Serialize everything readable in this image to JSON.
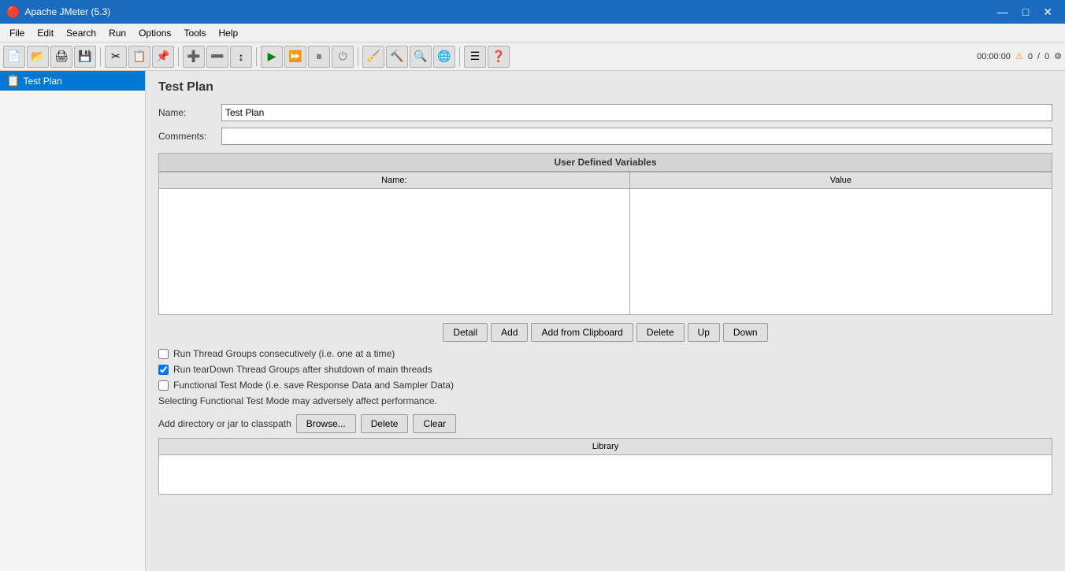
{
  "titlebar": {
    "icon": "🔴",
    "title": "Apache JMeter (5.3)",
    "minimize": "—",
    "maximize": "□",
    "close": "✕"
  },
  "menu": {
    "items": [
      "File",
      "Edit",
      "Search",
      "Run",
      "Options",
      "Tools",
      "Help"
    ]
  },
  "toolbar": {
    "buttons": [
      {
        "name": "new-btn",
        "icon": "📄"
      },
      {
        "name": "open-btn",
        "icon": "📂"
      },
      {
        "name": "save-copy-btn",
        "icon": "🖨"
      },
      {
        "name": "save-btn",
        "icon": "💾"
      },
      {
        "name": "cut-btn",
        "icon": "✂"
      },
      {
        "name": "copy-btn",
        "icon": "📋"
      },
      {
        "name": "paste-btn",
        "icon": "📌"
      },
      {
        "name": "expand-btn",
        "icon": "➕"
      },
      {
        "name": "collapse-btn",
        "icon": "➖"
      },
      {
        "name": "toggle-btn",
        "icon": "↕"
      },
      {
        "name": "play-btn",
        "icon": "▶"
      },
      {
        "name": "play-no-pause-btn",
        "icon": "⏩"
      },
      {
        "name": "stop-btn",
        "icon": "⏹"
      },
      {
        "name": "shutdown-btn",
        "icon": "⏻"
      },
      {
        "name": "clear-btn",
        "icon": "🔧"
      },
      {
        "name": "clear-all-btn",
        "icon": "🔨"
      },
      {
        "name": "search-btn",
        "icon": "🔍"
      },
      {
        "name": "remote-btn",
        "icon": "🔌"
      },
      {
        "name": "list-btn",
        "icon": "☰"
      },
      {
        "name": "help-btn",
        "icon": "❓"
      }
    ],
    "time": "00:00:00",
    "warning_icon": "⚠",
    "errors": "0",
    "separator": "/",
    "warnings": "0",
    "settings_icon": "⚙"
  },
  "tree": {
    "items": [
      {
        "label": "Test Plan",
        "icon": "📋",
        "selected": true
      }
    ]
  },
  "content": {
    "title": "Test Plan",
    "name_label": "Name:",
    "name_value": "Test Plan",
    "comments_label": "Comments:",
    "comments_value": "",
    "variables_section_title": "User Defined Variables",
    "table_headers": [
      "Name:",
      "Value"
    ],
    "buttons": {
      "detail": "Detail",
      "add": "Add",
      "add_from_clipboard": "Add from Clipboard",
      "delete": "Delete",
      "up": "Up",
      "down": "Down"
    },
    "checkbox1": {
      "label": "Run Thread Groups consecutively (i.e. one at a time)",
      "checked": false
    },
    "checkbox2": {
      "label": "Run tearDown Thread Groups after shutdown of main threads",
      "checked": true
    },
    "checkbox3": {
      "label": "Functional Test Mode (i.e. save Response Data and Sampler Data)",
      "checked": false
    },
    "perf_note": "Selecting Functional Test Mode may adversely affect performance.",
    "classpath_label": "Add directory or jar to classpath",
    "classpath_buttons": {
      "browse": "Browse...",
      "delete": "Delete",
      "clear": "Clear"
    },
    "library_header": "Library"
  }
}
